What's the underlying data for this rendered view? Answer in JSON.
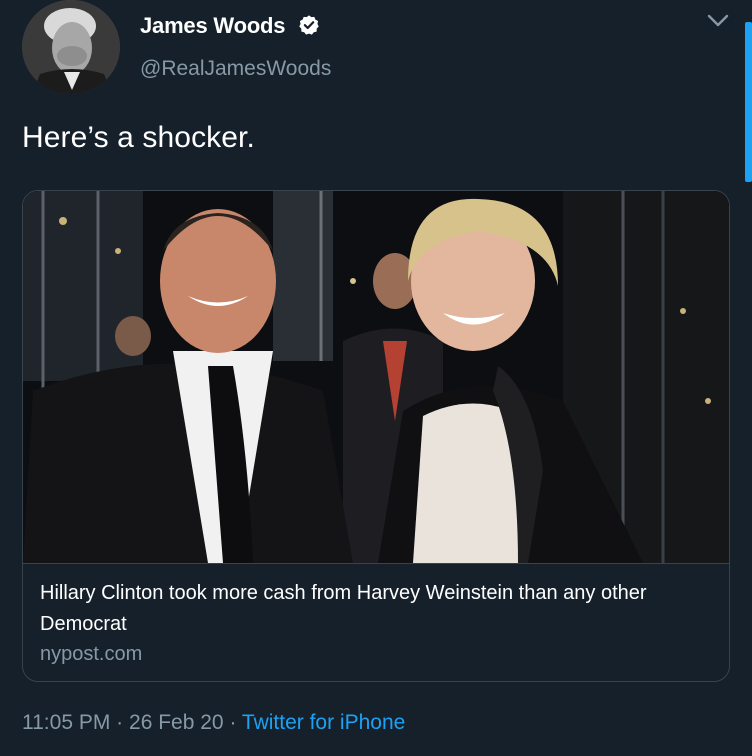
{
  "author": {
    "display_name": "James Woods",
    "handle": "@RealJamesWoods",
    "verified": true
  },
  "tweet": {
    "text": "Here’s a shocker."
  },
  "card": {
    "title": "Hillary Clinton took more cash from Harvey Weinstein than any other Democrat",
    "domain": "nypost.com"
  },
  "meta": {
    "time": "11:05 PM",
    "separator": "·",
    "date": "26 Feb 20",
    "source": "Twitter for iPhone"
  },
  "icons": {
    "verified": "verified-badge-icon",
    "chevron": "chevron-down-icon"
  },
  "colors": {
    "background": "#15202b",
    "secondary_text": "#8899a6",
    "accent": "#1da1f2",
    "border": "#38444d"
  }
}
